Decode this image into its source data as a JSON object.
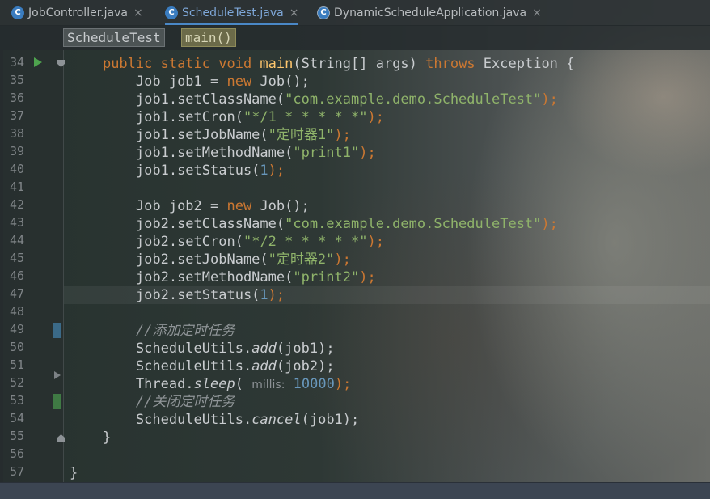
{
  "tabs": [
    {
      "label": "JobController.java",
      "icon": "C"
    },
    {
      "label": "ScheduleTest.java",
      "icon": "C"
    },
    {
      "label": "DynamicScheduleApplication.java",
      "icon": "C"
    }
  ],
  "close_glyph": "×",
  "breadcrumb": {
    "class_name": "ScheduleTest",
    "method_name": "main()"
  },
  "line_numbers": [
    "34",
    "35",
    "36",
    "37",
    "38",
    "39",
    "40",
    "41",
    "42",
    "43",
    "44",
    "45",
    "46",
    "47",
    "48",
    "49",
    "50",
    "51",
    "52",
    "53",
    "54",
    "55",
    "56",
    "57"
  ],
  "code": {
    "l34": {
      "mod": "public static void ",
      "fn": "main",
      "sig": "(String[] args) ",
      "kw_throws": "throws",
      "exc": " Exception {"
    },
    "l35": {
      "pre": "    Job job1 = ",
      "kw": "new",
      "post": " Job();"
    },
    "l36": {
      "pre": "    job1.setClassName(",
      "str": "\"com.example.demo.ScheduleTest\"",
      "post": ");"
    },
    "l37": {
      "pre": "    job1.setCron(",
      "str": "\"*/1 * * * * *\"",
      "post": ");"
    },
    "l38": {
      "pre": "    job1.setJobName(",
      "str": "\"定时器1\"",
      "post": ");"
    },
    "l39": {
      "pre": "    job1.setMethodName(",
      "str": "\"print1\"",
      "post": ");"
    },
    "l40": {
      "pre": "    job1.setStatus(",
      "num": "1",
      "post": ");"
    },
    "l42": {
      "pre": "    Job job2 = ",
      "kw": "new",
      "post": " Job();"
    },
    "l43": {
      "pre": "    job2.setClassName(",
      "str": "\"com.example.demo.ScheduleTest\"",
      "post": ");"
    },
    "l44": {
      "pre": "    job2.setCron(",
      "str": "\"*/2 * * * * *\"",
      "post": ");"
    },
    "l45": {
      "pre": "    job2.setJobName(",
      "str": "\"定时器2\"",
      "post": ");"
    },
    "l46": {
      "pre": "    job2.setMethodName(",
      "str": "\"print2\"",
      "post": ");"
    },
    "l47": {
      "pre": "    job2.setStatus(",
      "num": "1",
      "post": ");"
    },
    "l49": {
      "comment": "    //添加定时任务"
    },
    "l50": {
      "pre": "    ScheduleUtils.",
      "it": "add",
      "post": "(job1);"
    },
    "l51": {
      "pre": "    ScheduleUtils.",
      "it": "add",
      "post": "(job2);"
    },
    "l52": {
      "pre": "    Thread.",
      "it": "sleep",
      "open": "( ",
      "hint": "millis:",
      "num": " 10000",
      "post": ");"
    },
    "l53": {
      "comment": "    //关闭定时任务"
    },
    "l54": {
      "pre": "    ScheduleUtils.",
      "it": "cancel",
      "post": "(job1);"
    },
    "l55": {
      "text": "}"
    },
    "l57": {
      "text": "}"
    }
  },
  "colors": {
    "keyword": "#cc7832",
    "function": "#ffc66d",
    "string": "#8fb36a",
    "number": "#6897bb",
    "comment": "#8f9497"
  },
  "icons": {
    "run": "run-gutter-icon",
    "file": "java-class-icon"
  }
}
